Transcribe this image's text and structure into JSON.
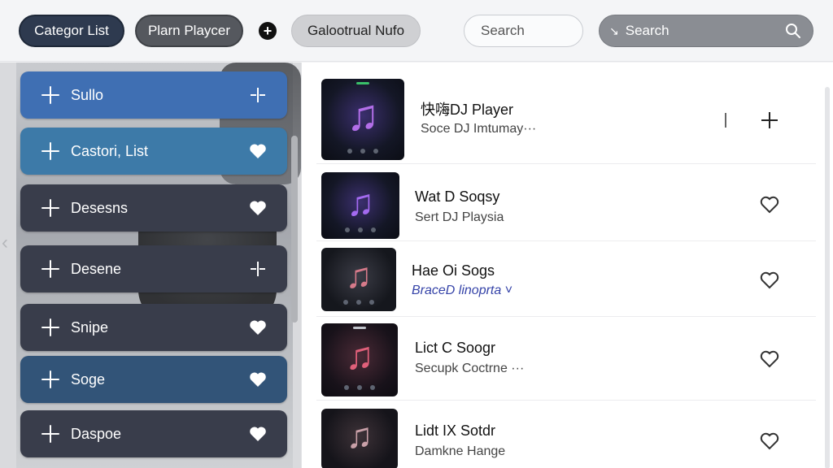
{
  "topbar": {
    "category_label": "Categor List",
    "player_label": "Plarn Playcer",
    "gallery_label": "Galootrual Nufo",
    "search_light_placeholder": "Search",
    "search_dark_lead": "↘",
    "search_dark_placeholder": "Search"
  },
  "sidebar": {
    "items": [
      {
        "label": "Sullo",
        "color": "#3f6fb3",
        "icon": "split-icon"
      },
      {
        "label": "Castori, List",
        "color": "#3d7aa8",
        "icon": "heart-icon"
      },
      {
        "label": "Desesns",
        "color": "#393d4b",
        "icon": "heart-icon"
      },
      {
        "label": "Desene",
        "color": "#393d4b",
        "icon": "split-icon"
      },
      {
        "label": "Snipe",
        "color": "#393d4b",
        "icon": "heart-icon"
      },
      {
        "label": "Soge",
        "color": "#325478",
        "icon": "heart-icon"
      },
      {
        "label": "Daspoe",
        "color": "#393d4b",
        "icon": "heart-icon"
      }
    ]
  },
  "tracks": [
    {
      "title": "快嗨DJ Player",
      "subtitle": "Soce DJ Imtumay···",
      "action": "add",
      "note_color": "#b26ee8"
    },
    {
      "title": "Wat D Soqsy",
      "subtitle": "Sert DJ Playsia",
      "action": "heart",
      "note_color": "#a36af0"
    },
    {
      "title": "Hae Oi Sogs",
      "subtitle": "BraceD linoprta ˅",
      "action": "heart",
      "note_color": "#d67a8a"
    },
    {
      "title": "Lict C Soogr",
      "subtitle": "Secupk Coctrne ···",
      "action": "heart",
      "note_color": "#e0607a"
    },
    {
      "title": "Lidt IX Sotdr",
      "subtitle": "Damkne Hange",
      "action": "heart",
      "note_color": "#c9a0a8"
    }
  ],
  "colors": {
    "accent_blue": "#3f6fb3",
    "slate": "#393d4b",
    "navy": "#325478"
  }
}
